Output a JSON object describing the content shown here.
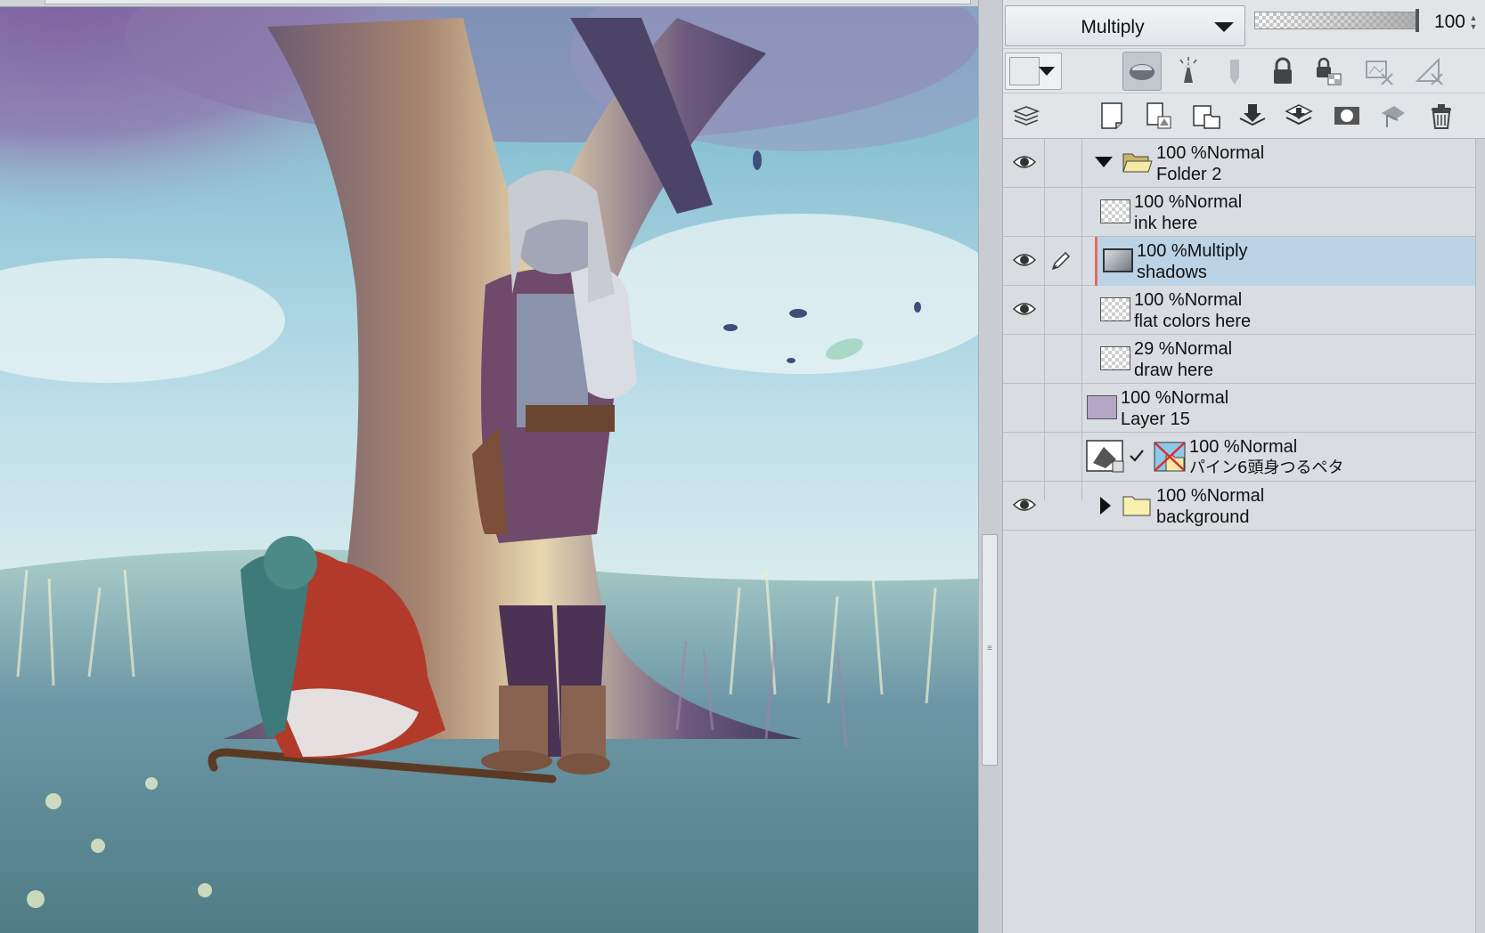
{
  "layer_properties": {
    "blend_mode": "Multiply",
    "opacity_value": "100",
    "opacity_fraction": 1.0
  },
  "property_tools": [
    "color-dropdown-icon",
    "clip-to-layer-below-icon",
    "reference-layer-icon",
    "draft-layer-icon",
    "lock-layer-icon",
    "lock-transparency-icon",
    "mask-disable-icon",
    "ruler-disable-icon"
  ],
  "command_tools": [
    "layer-stack-icon",
    "new-raster-layer-icon",
    "new-vector-layer-icon",
    "new-folder-icon",
    "transfer-down-icon",
    "merge-down-icon",
    "create-mask-icon",
    "apply-mask-icon",
    "delete-layer-icon"
  ],
  "layers": [
    {
      "opacity": "100 %",
      "mode": "Normal",
      "name": "Folder 2",
      "visible": true,
      "kind": "folder",
      "expanded": true
    },
    {
      "opacity": "100 %",
      "mode": "Normal",
      "name": "ink here",
      "visible": false,
      "kind": "raster"
    },
    {
      "opacity": "100 %",
      "mode": "Multiply",
      "name": "shadows",
      "visible": true,
      "kind": "raster",
      "selected": true
    },
    {
      "opacity": "100 %",
      "mode": "Normal",
      "name": "flat colors here",
      "visible": true,
      "kind": "raster"
    },
    {
      "opacity": "29 %",
      "mode": "Normal",
      "name": "draw here",
      "visible": false,
      "kind": "raster"
    },
    {
      "opacity": "100 %",
      "mode": "Normal",
      "name": "Layer 15",
      "visible": false,
      "kind": "paper",
      "color": "#b4a6c4"
    },
    {
      "opacity": "100 %",
      "mode": "Normal",
      "name": "パイン6頭身つるペタ",
      "visible": false,
      "kind": "3d"
    },
    {
      "opacity": "100 %",
      "mode": "Normal",
      "name": "background",
      "visible": true,
      "kind": "folder",
      "expanded": false
    }
  ],
  "colors": {
    "selected_row": "#bcd3e6",
    "selected_marker": "#e46a62",
    "panel_bg": "#d9dde1"
  }
}
